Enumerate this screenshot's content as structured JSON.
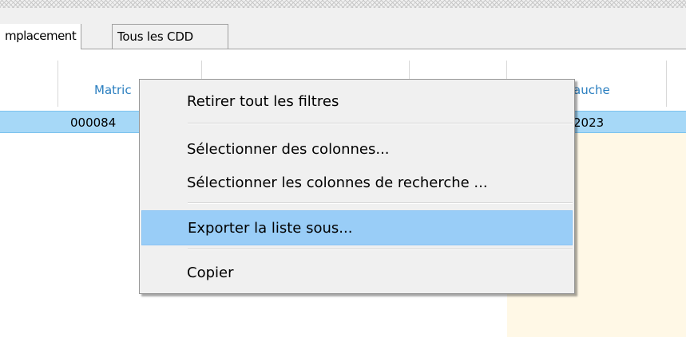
{
  "tabs": [
    {
      "label": "mplacement"
    },
    {
      "label": "Tous les CDD"
    }
  ],
  "grid": {
    "headers": [
      "Matric",
      "auche"
    ],
    "row": {
      "matricule": "000084",
      "date": "2023"
    }
  },
  "context_menu": {
    "items": [
      "Retirer tout les filtres",
      "Sélectionner des colonnes...",
      "Sélectionner les colonnes de recherche ...",
      "Exporter la liste sous...",
      "Copier"
    ],
    "highlighted_index": 3
  },
  "colors": {
    "selected_row": "#a6d8f7",
    "menu_highlight": "#99cdf7",
    "header_text": "#2b7fc0",
    "empty_area": "#fff8e6"
  }
}
